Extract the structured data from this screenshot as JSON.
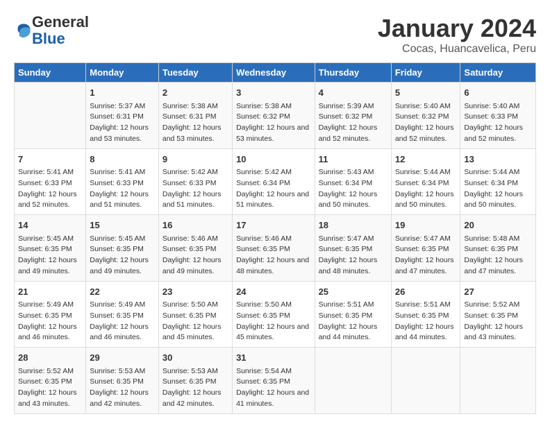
{
  "header": {
    "logo_general": "General",
    "logo_blue": "Blue",
    "month_title": "January 2024",
    "location": "Cocas, Huancavelica, Peru"
  },
  "days_of_week": [
    "Sunday",
    "Monday",
    "Tuesday",
    "Wednesday",
    "Thursday",
    "Friday",
    "Saturday"
  ],
  "weeks": [
    [
      {
        "day": "",
        "sunrise": "",
        "sunset": "",
        "daylight": ""
      },
      {
        "day": "1",
        "sunrise": "Sunrise: 5:37 AM",
        "sunset": "Sunset: 6:31 PM",
        "daylight": "Daylight: 12 hours and 53 minutes."
      },
      {
        "day": "2",
        "sunrise": "Sunrise: 5:38 AM",
        "sunset": "Sunset: 6:31 PM",
        "daylight": "Daylight: 12 hours and 53 minutes."
      },
      {
        "day": "3",
        "sunrise": "Sunrise: 5:38 AM",
        "sunset": "Sunset: 6:32 PM",
        "daylight": "Daylight: 12 hours and 53 minutes."
      },
      {
        "day": "4",
        "sunrise": "Sunrise: 5:39 AM",
        "sunset": "Sunset: 6:32 PM",
        "daylight": "Daylight: 12 hours and 52 minutes."
      },
      {
        "day": "5",
        "sunrise": "Sunrise: 5:40 AM",
        "sunset": "Sunset: 6:32 PM",
        "daylight": "Daylight: 12 hours and 52 minutes."
      },
      {
        "day": "6",
        "sunrise": "Sunrise: 5:40 AM",
        "sunset": "Sunset: 6:33 PM",
        "daylight": "Daylight: 12 hours and 52 minutes."
      }
    ],
    [
      {
        "day": "7",
        "sunrise": "Sunrise: 5:41 AM",
        "sunset": "Sunset: 6:33 PM",
        "daylight": "Daylight: 12 hours and 52 minutes."
      },
      {
        "day": "8",
        "sunrise": "Sunrise: 5:41 AM",
        "sunset": "Sunset: 6:33 PM",
        "daylight": "Daylight: 12 hours and 51 minutes."
      },
      {
        "day": "9",
        "sunrise": "Sunrise: 5:42 AM",
        "sunset": "Sunset: 6:33 PM",
        "daylight": "Daylight: 12 hours and 51 minutes."
      },
      {
        "day": "10",
        "sunrise": "Sunrise: 5:42 AM",
        "sunset": "Sunset: 6:34 PM",
        "daylight": "Daylight: 12 hours and 51 minutes."
      },
      {
        "day": "11",
        "sunrise": "Sunrise: 5:43 AM",
        "sunset": "Sunset: 6:34 PM",
        "daylight": "Daylight: 12 hours and 50 minutes."
      },
      {
        "day": "12",
        "sunrise": "Sunrise: 5:44 AM",
        "sunset": "Sunset: 6:34 PM",
        "daylight": "Daylight: 12 hours and 50 minutes."
      },
      {
        "day": "13",
        "sunrise": "Sunrise: 5:44 AM",
        "sunset": "Sunset: 6:34 PM",
        "daylight": "Daylight: 12 hours and 50 minutes."
      }
    ],
    [
      {
        "day": "14",
        "sunrise": "Sunrise: 5:45 AM",
        "sunset": "Sunset: 6:35 PM",
        "daylight": "Daylight: 12 hours and 49 minutes."
      },
      {
        "day": "15",
        "sunrise": "Sunrise: 5:45 AM",
        "sunset": "Sunset: 6:35 PM",
        "daylight": "Daylight: 12 hours and 49 minutes."
      },
      {
        "day": "16",
        "sunrise": "Sunrise: 5:46 AM",
        "sunset": "Sunset: 6:35 PM",
        "daylight": "Daylight: 12 hours and 49 minutes."
      },
      {
        "day": "17",
        "sunrise": "Sunrise: 5:46 AM",
        "sunset": "Sunset: 6:35 PM",
        "daylight": "Daylight: 12 hours and 48 minutes."
      },
      {
        "day": "18",
        "sunrise": "Sunrise: 5:47 AM",
        "sunset": "Sunset: 6:35 PM",
        "daylight": "Daylight: 12 hours and 48 minutes."
      },
      {
        "day": "19",
        "sunrise": "Sunrise: 5:47 AM",
        "sunset": "Sunset: 6:35 PM",
        "daylight": "Daylight: 12 hours and 47 minutes."
      },
      {
        "day": "20",
        "sunrise": "Sunrise: 5:48 AM",
        "sunset": "Sunset: 6:35 PM",
        "daylight": "Daylight: 12 hours and 47 minutes."
      }
    ],
    [
      {
        "day": "21",
        "sunrise": "Sunrise: 5:49 AM",
        "sunset": "Sunset: 6:35 PM",
        "daylight": "Daylight: 12 hours and 46 minutes."
      },
      {
        "day": "22",
        "sunrise": "Sunrise: 5:49 AM",
        "sunset": "Sunset: 6:35 PM",
        "daylight": "Daylight: 12 hours and 46 minutes."
      },
      {
        "day": "23",
        "sunrise": "Sunrise: 5:50 AM",
        "sunset": "Sunset: 6:35 PM",
        "daylight": "Daylight: 12 hours and 45 minutes."
      },
      {
        "day": "24",
        "sunrise": "Sunrise: 5:50 AM",
        "sunset": "Sunset: 6:35 PM",
        "daylight": "Daylight: 12 hours and 45 minutes."
      },
      {
        "day": "25",
        "sunrise": "Sunrise: 5:51 AM",
        "sunset": "Sunset: 6:35 PM",
        "daylight": "Daylight: 12 hours and 44 minutes."
      },
      {
        "day": "26",
        "sunrise": "Sunrise: 5:51 AM",
        "sunset": "Sunset: 6:35 PM",
        "daylight": "Daylight: 12 hours and 44 minutes."
      },
      {
        "day": "27",
        "sunrise": "Sunrise: 5:52 AM",
        "sunset": "Sunset: 6:35 PM",
        "daylight": "Daylight: 12 hours and 43 minutes."
      }
    ],
    [
      {
        "day": "28",
        "sunrise": "Sunrise: 5:52 AM",
        "sunset": "Sunset: 6:35 PM",
        "daylight": "Daylight: 12 hours and 43 minutes."
      },
      {
        "day": "29",
        "sunrise": "Sunrise: 5:53 AM",
        "sunset": "Sunset: 6:35 PM",
        "daylight": "Daylight: 12 hours and 42 minutes."
      },
      {
        "day": "30",
        "sunrise": "Sunrise: 5:53 AM",
        "sunset": "Sunset: 6:35 PM",
        "daylight": "Daylight: 12 hours and 42 minutes."
      },
      {
        "day": "31",
        "sunrise": "Sunrise: 5:54 AM",
        "sunset": "Sunset: 6:35 PM",
        "daylight": "Daylight: 12 hours and 41 minutes."
      },
      {
        "day": "",
        "sunrise": "",
        "sunset": "",
        "daylight": ""
      },
      {
        "day": "",
        "sunrise": "",
        "sunset": "",
        "daylight": ""
      },
      {
        "day": "",
        "sunrise": "",
        "sunset": "",
        "daylight": ""
      }
    ]
  ]
}
